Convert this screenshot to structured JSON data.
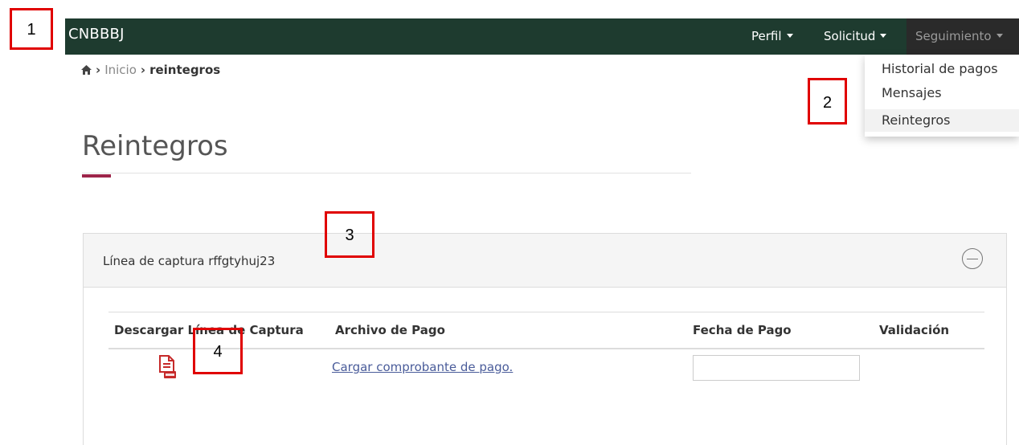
{
  "navbar": {
    "brand": "CNBBBJ",
    "items": [
      {
        "label": "Perfil"
      },
      {
        "label": "Solicitud"
      },
      {
        "label": "Seguimiento"
      }
    ]
  },
  "dropdown": {
    "items": [
      {
        "label": "Historial de pagos"
      },
      {
        "label": "Mensajes"
      },
      {
        "label": "Reintegros"
      }
    ],
    "active_item": "Reintegros"
  },
  "breadcrumb": {
    "home_icon": "home-icon",
    "items": [
      "Inicio",
      "reintegros"
    ]
  },
  "page": {
    "title": "Reintegros"
  },
  "panel": {
    "title": "Línea de captura rffgtyhuj23",
    "collapse_icon": "minus-circle-icon",
    "columns": [
      "Descargar Línea de Captura",
      "Archivo de Pago",
      "Fecha de Pago",
      "Validación"
    ],
    "row": {
      "download_icon": "pdf-icon",
      "upload_link": "Cargar comprobante de pago.",
      "date_value": "",
      "validation": ""
    }
  },
  "annotations": [
    "1",
    "2",
    "3",
    "4"
  ],
  "colors": {
    "navbar_bg": "#1e3b2f",
    "accent": "#9d2449",
    "pdf_red": "#c62a2a",
    "marker_red": "#e00000",
    "link": "#4a5c9a"
  }
}
